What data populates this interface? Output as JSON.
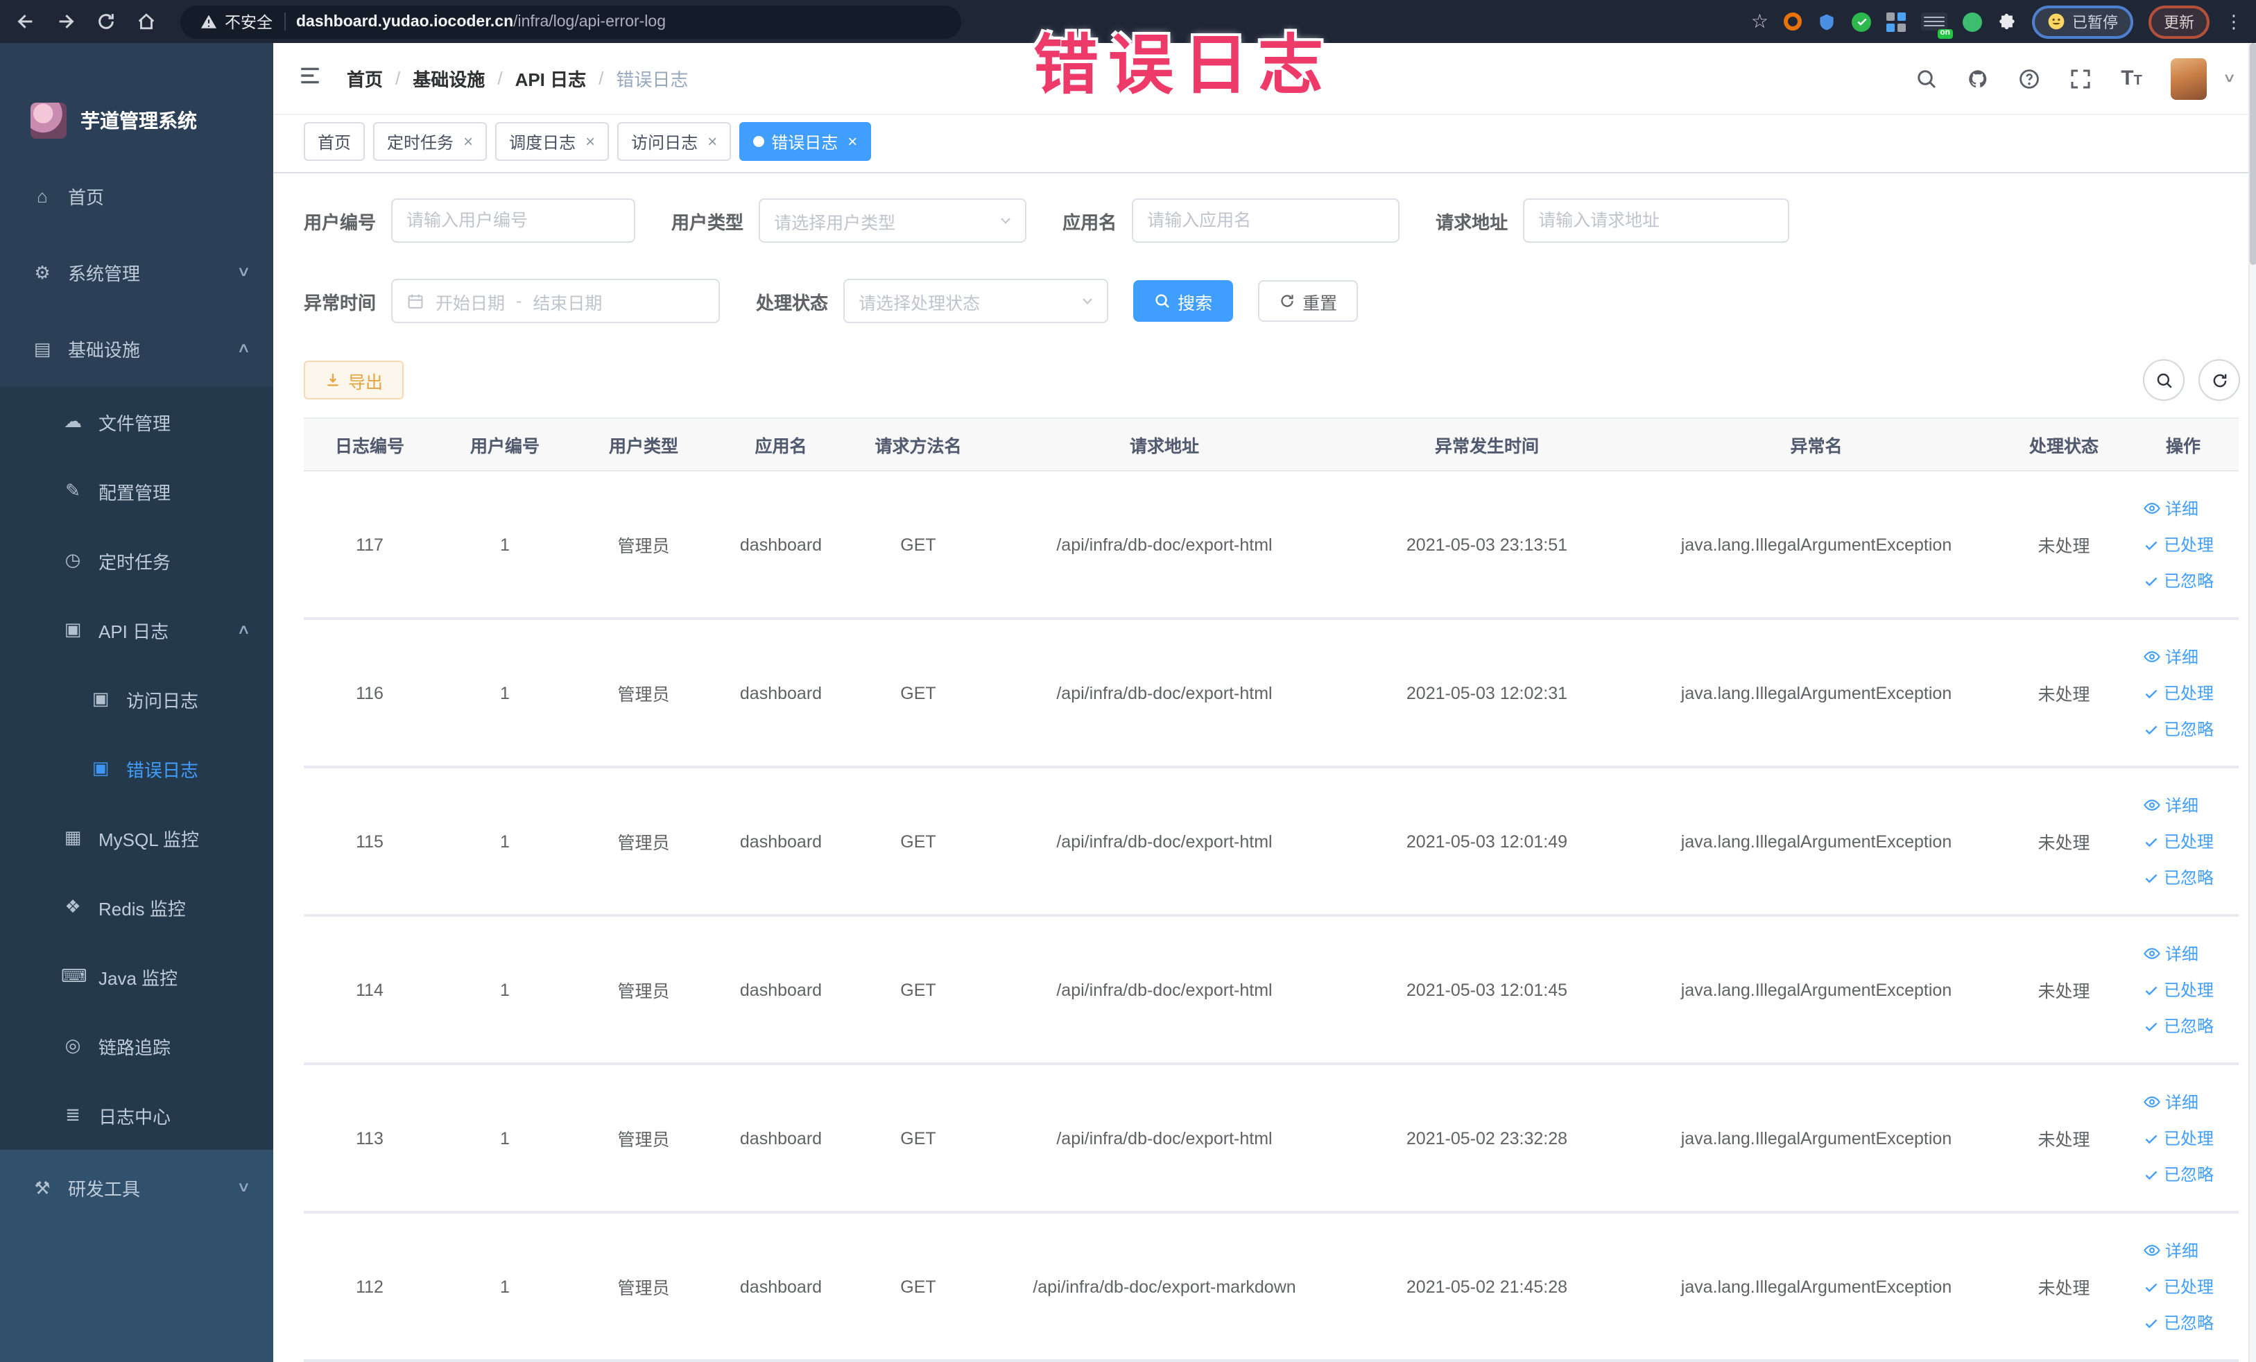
{
  "browser": {
    "security_label": "不安全",
    "url_domain": "dashboard.yudao.iocoder.cn",
    "url_path": "/infra/log/api-error-log",
    "ext_on_badge": "on",
    "paused_label": "已暂停",
    "update_label": "更新"
  },
  "annotation": {
    "text": "错误日志"
  },
  "sidebar": {
    "title": "芋道管理系统",
    "items": [
      {
        "icon": "home",
        "label": "首页",
        "level": "root"
      },
      {
        "icon": "gear",
        "label": "系统管理",
        "level": "root",
        "arrow": "down"
      },
      {
        "icon": "infra",
        "label": "基础设施",
        "level": "root",
        "arrow": "up"
      },
      {
        "icon": "file",
        "label": "文件管理",
        "level": "sub"
      },
      {
        "icon": "config",
        "label": "配置管理",
        "level": "sub"
      },
      {
        "icon": "cron",
        "label": "定时任务",
        "level": "sub"
      },
      {
        "icon": "apilog",
        "label": "API 日志",
        "level": "sub",
        "arrow": "up"
      },
      {
        "icon": "accesslog",
        "label": "访问日志",
        "level": "subsub"
      },
      {
        "icon": "errorlog",
        "label": "错误日志",
        "level": "subsub",
        "active": true
      },
      {
        "icon": "mysql",
        "label": "MySQL 监控",
        "level": "sub"
      },
      {
        "icon": "redis",
        "label": "Redis 监控",
        "level": "sub"
      },
      {
        "icon": "java",
        "label": "Java 监控",
        "level": "sub"
      },
      {
        "icon": "trace",
        "label": "链路追踪",
        "level": "sub"
      },
      {
        "icon": "logcenter",
        "label": "日志中心",
        "level": "sub"
      },
      {
        "icon": "tools",
        "label": "研发工具",
        "level": "root2",
        "arrow": "down"
      }
    ]
  },
  "breadcrumb": {
    "items": [
      "首页",
      "基础设施",
      "API 日志",
      "错误日志"
    ]
  },
  "tabs": [
    {
      "label": "首页",
      "closable": false,
      "active": false
    },
    {
      "label": "定时任务",
      "closable": true,
      "active": false
    },
    {
      "label": "调度日志",
      "closable": true,
      "active": false
    },
    {
      "label": "访问日志",
      "closable": true,
      "active": false
    },
    {
      "label": "错误日志",
      "closable": true,
      "active": true
    }
  ],
  "filters": {
    "user_id": {
      "label": "用户编号",
      "placeholder": "请输入用户编号"
    },
    "user_type": {
      "label": "用户类型",
      "placeholder": "请选择用户类型"
    },
    "app_name": {
      "label": "应用名",
      "placeholder": "请输入应用名"
    },
    "request_url": {
      "label": "请求地址",
      "placeholder": "请输入请求地址"
    },
    "exception_time": {
      "label": "异常时间",
      "start_placeholder": "开始日期",
      "separator": "-",
      "end_placeholder": "结束日期"
    },
    "process_status": {
      "label": "处理状态",
      "placeholder": "请选择处理状态"
    },
    "search_label": "搜索",
    "reset_label": "重置"
  },
  "toolbar": {
    "export_label": "导出"
  },
  "table": {
    "columns": [
      "日志编号",
      "用户编号",
      "用户类型",
      "应用名",
      "请求方法名",
      "请求地址",
      "异常发生时间",
      "异常名",
      "处理状态",
      "操作"
    ],
    "actions": [
      {
        "label": "详细",
        "icon": "eye"
      },
      {
        "label": "已处理",
        "icon": "check"
      },
      {
        "label": "已忽略",
        "icon": "check"
      }
    ],
    "rows": [
      {
        "id": "117",
        "user_id": "1",
        "user_type": "管理员",
        "app": "dashboard",
        "method": "GET",
        "url": "/api/infra/db-doc/export-html",
        "time": "2021-05-03 23:13:51",
        "exception": "java.lang.IllegalArgumentException",
        "status": "未处理"
      },
      {
        "id": "116",
        "user_id": "1",
        "user_type": "管理员",
        "app": "dashboard",
        "method": "GET",
        "url": "/api/infra/db-doc/export-html",
        "time": "2021-05-03 12:02:31",
        "exception": "java.lang.IllegalArgumentException",
        "status": "未处理"
      },
      {
        "id": "115",
        "user_id": "1",
        "user_type": "管理员",
        "app": "dashboard",
        "method": "GET",
        "url": "/api/infra/db-doc/export-html",
        "time": "2021-05-03 12:01:49",
        "exception": "java.lang.IllegalArgumentException",
        "status": "未处理"
      },
      {
        "id": "114",
        "user_id": "1",
        "user_type": "管理员",
        "app": "dashboard",
        "method": "GET",
        "url": "/api/infra/db-doc/export-html",
        "time": "2021-05-03 12:01:45",
        "exception": "java.lang.IllegalArgumentException",
        "status": "未处理"
      },
      {
        "id": "113",
        "user_id": "1",
        "user_type": "管理员",
        "app": "dashboard",
        "method": "GET",
        "url": "/api/infra/db-doc/export-html",
        "time": "2021-05-02 23:32:28",
        "exception": "java.lang.IllegalArgumentException",
        "status": "未处理"
      },
      {
        "id": "112",
        "user_id": "1",
        "user_type": "管理员",
        "app": "dashboard",
        "method": "GET",
        "url": "/api/infra/db-doc/export-markdown",
        "time": "2021-05-02 21:45:28",
        "exception": "java.lang.IllegalArgumentException",
        "status": "未处理"
      }
    ]
  },
  "colors": {
    "accent": "#409eff",
    "sidebar_bg": "#2b4056",
    "sidebar_sub_bg": "#24394c",
    "warning_text": "#e6a23c",
    "annotation": "#ee3a68"
  }
}
